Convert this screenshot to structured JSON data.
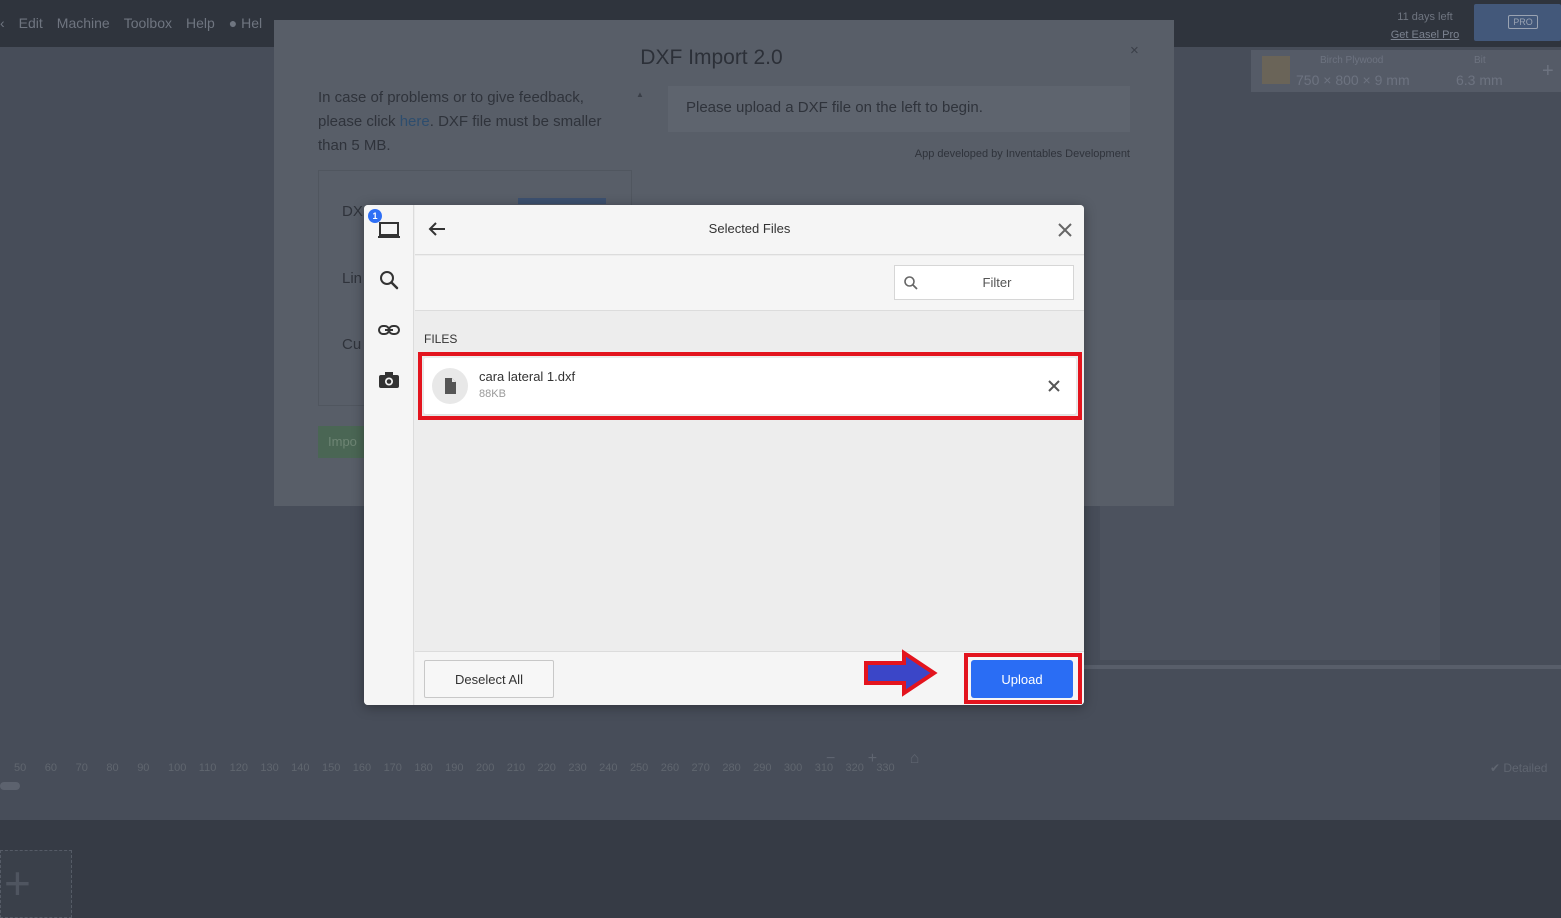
{
  "app": {
    "menu": [
      "‹",
      "Edit",
      "Machine",
      "Toolbox",
      "Help",
      "● Hel"
    ],
    "trial": {
      "days": "11 days left",
      "link": "Get Easel Pro"
    },
    "pro_chip": "PRO",
    "material": {
      "label": "Birch Plywood",
      "value": "750 × 800 × 9 mm"
    },
    "bit": {
      "label": "Bit",
      "value": "6.3 mm"
    },
    "ruler_ticks": [
      "50",
      "60",
      "70",
      "80",
      "90",
      "100",
      "110",
      "120",
      "130",
      "140",
      "150",
      "160",
      "170",
      "180",
      "190",
      "200",
      "210",
      "220",
      "230",
      "240",
      "250",
      "260",
      "270",
      "280",
      "290",
      "300",
      "310",
      "320",
      "330"
    ],
    "zoom_controls": "− + ⌂",
    "detailed_label": "✔ Detailed",
    "add_plus": "+"
  },
  "dxf_dialog": {
    "title": "DXF Import 2.0",
    "close": "×",
    "intro_before_link": "In case of problems or to give feedback, please click ",
    "intro_link": "here",
    "intro_after_link": ". DXF file must be smaller than 5 MB.",
    "scroll_glyph": "▲",
    "form_row_labels": [
      "DX",
      "Lin",
      "Cu"
    ],
    "import_button": "Impo",
    "message": "Please upload a DXF file on the left to begin.",
    "credit": "App developed by Inventables Development"
  },
  "picker": {
    "badge_count": "1",
    "title": "Selected Files",
    "filter_placeholder": "Filter",
    "section_label": "FILES",
    "files": [
      {
        "name": "cara lateral 1.dxf",
        "size": "88KB"
      }
    ],
    "deselect_label": "Deselect All",
    "upload_label": "Upload"
  },
  "colors": {
    "accent": "#2a6df4",
    "highlight": "#e3141e",
    "arrow_fill": "#3b46c8"
  }
}
